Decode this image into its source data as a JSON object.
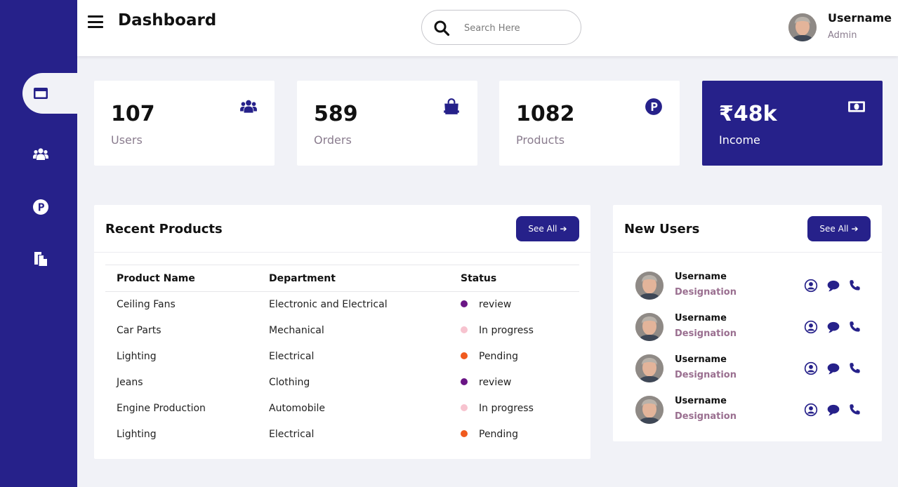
{
  "header": {
    "title": "Dashboard",
    "search_placeholder": "Search Here",
    "user_name": "Username",
    "user_role": "Admin"
  },
  "sidebar": {
    "items": [
      {
        "icon": "window-icon",
        "active": true
      },
      {
        "icon": "users-icon",
        "active": false
      },
      {
        "icon": "parking-icon",
        "active": false
      },
      {
        "icon": "copy-icon",
        "active": false
      }
    ]
  },
  "stats": [
    {
      "value": "107",
      "label": "Users",
      "icon": "users-icon"
    },
    {
      "value": "589",
      "label": "Orders",
      "icon": "shopping-bag-icon"
    },
    {
      "value": "1082",
      "label": "Products",
      "icon": "parking-icon"
    },
    {
      "value": "₹48k",
      "label": "Income",
      "icon": "money-bill-icon"
    }
  ],
  "recent_products": {
    "title": "Recent Products",
    "see_all": "See All",
    "columns": [
      "Product Name",
      "Department",
      "Status"
    ],
    "rows": [
      {
        "name": "Ceiling Fans",
        "department": "Electronic and Electrical",
        "status": "review",
        "color": "#6a1585"
      },
      {
        "name": "Car Parts",
        "department": "Mechanical",
        "status": "In progress",
        "color": "#f7c3cf"
      },
      {
        "name": "Lighting",
        "department": "Electrical",
        "status": "Pending",
        "color": "#f05a1e"
      },
      {
        "name": "Jeans",
        "department": "Clothing",
        "status": "review",
        "color": "#6a1585"
      },
      {
        "name": "Engine Production",
        "department": "Automobile",
        "status": "In progress",
        "color": "#f7c3cf"
      },
      {
        "name": "Lighting",
        "department": "Electrical",
        "status": "Pending",
        "color": "#f05a1e"
      }
    ]
  },
  "new_users": {
    "title": "New Users",
    "see_all": "See All",
    "users": [
      {
        "name": "Username",
        "designation": "Designation"
      },
      {
        "name": "Username",
        "designation": "Designation"
      },
      {
        "name": "Username",
        "designation": "Designation"
      },
      {
        "name": "Username",
        "designation": "Designation"
      }
    ]
  },
  "colors": {
    "primary": "#26218a",
    "background": "#f1f2f7",
    "muted_label": "#8a7c8e",
    "designation": "#9a6f90"
  }
}
